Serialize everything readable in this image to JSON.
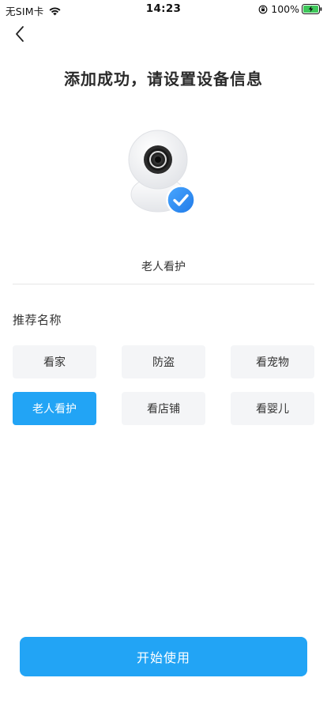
{
  "status_bar": {
    "carrier": "无SIM卡",
    "time": "14:23",
    "battery": "100%",
    "icons": [
      "wifi-icon",
      "orientation-lock-icon",
      "battery-charging-icon"
    ]
  },
  "nav": {
    "back_icon": "chevron-left-icon"
  },
  "title": "添加成功，请设置设备信息",
  "device": {
    "illustration": "camera-icon",
    "badge": "checkmark-icon",
    "badge_color": "#2a8cf0",
    "name_value": "老人看护"
  },
  "suggestions": {
    "title": "推荐名称",
    "options": [
      {
        "label": "看家",
        "selected": false
      },
      {
        "label": "防盗",
        "selected": false
      },
      {
        "label": "看宠物",
        "selected": false
      },
      {
        "label": "老人看护",
        "selected": true
      },
      {
        "label": "看店铺",
        "selected": false
      },
      {
        "label": "看婴儿",
        "selected": false
      }
    ]
  },
  "primary_action": {
    "label": "开始使用"
  },
  "colors": {
    "accent": "#22a4f5",
    "chip_bg": "#f4f5f7",
    "text": "#333333"
  }
}
